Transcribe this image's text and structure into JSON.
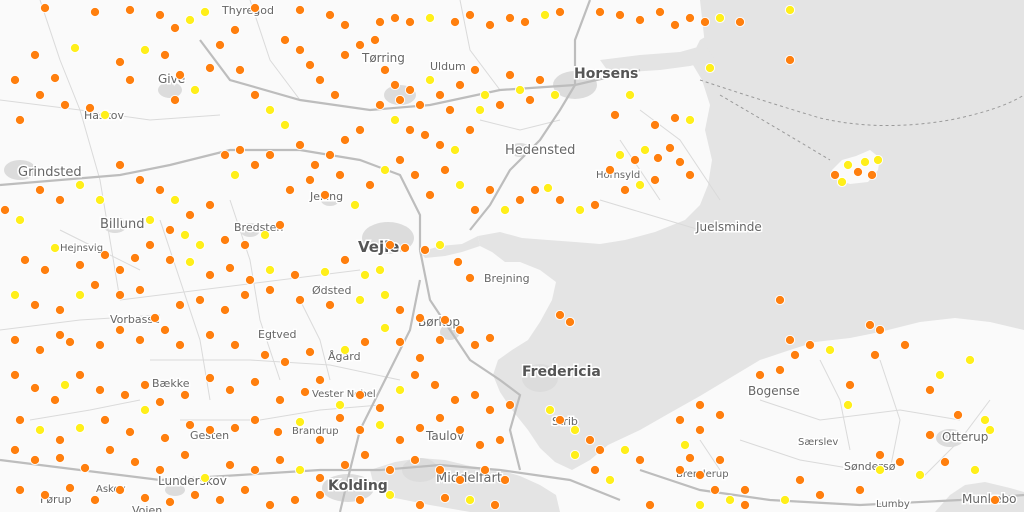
{
  "map": {
    "colors": {
      "land": "#fafafa",
      "sea": "#e4e4e4",
      "urban": "#dcdcdc",
      "road_major": "#bdbdbd",
      "road_minor": "#dadada",
      "ferry": "#9a9a9a",
      "marker_orange": "#ff7f0e",
      "marker_yellow": "#ffef1a"
    },
    "towns": [
      {
        "id": "thyregod",
        "name": "Thyregod"
      },
      {
        "id": "torring",
        "name": "Tørring"
      },
      {
        "id": "uldum",
        "name": "Uldum"
      },
      {
        "id": "horsens",
        "name": "Horsens"
      },
      {
        "id": "give",
        "name": "Give"
      },
      {
        "id": "haskov",
        "name": "Haskov"
      },
      {
        "id": "hedensted",
        "name": "Hedensted"
      },
      {
        "id": "grindsted",
        "name": "Grindsted"
      },
      {
        "id": "juelsminde",
        "name": "Juelsminde"
      },
      {
        "id": "hornsyld",
        "name": "Hornsyld"
      },
      {
        "id": "jelling",
        "name": "Jelling"
      },
      {
        "id": "billund",
        "name": "Billund"
      },
      {
        "id": "bredsten",
        "name": "Bredsten"
      },
      {
        "id": "vejle",
        "name": "Vejle"
      },
      {
        "id": "hejnsvig",
        "name": "Hejnsvig"
      },
      {
        "id": "brejning",
        "name": "Brejning"
      },
      {
        "id": "odsted",
        "name": "Ødsted"
      },
      {
        "id": "vorbasse",
        "name": "Vorbasse"
      },
      {
        "id": "egtved",
        "name": "Egtved"
      },
      {
        "id": "borkop",
        "name": "Børkop"
      },
      {
        "id": "agard",
        "name": "Ågård"
      },
      {
        "id": "fredericia",
        "name": "Fredericia"
      },
      {
        "id": "baekke",
        "name": "Bække"
      },
      {
        "id": "vester-nebel",
        "name": "Vester Nebel"
      },
      {
        "id": "bogense",
        "name": "Bogense"
      },
      {
        "id": "strib",
        "name": "Strib"
      },
      {
        "id": "gesten",
        "name": "Gesten"
      },
      {
        "id": "bramdrup",
        "name": "Brandrup"
      },
      {
        "id": "taulov",
        "name": "Taulov"
      },
      {
        "id": "saersleo",
        "name": "Særslev"
      },
      {
        "id": "otterup",
        "name": "Otterup"
      },
      {
        "id": "lunderskov",
        "name": "Lunderskov"
      },
      {
        "id": "kolding",
        "name": "Kolding"
      },
      {
        "id": "middelfart",
        "name": "Middelfart"
      },
      {
        "id": "brenderup",
        "name": "Brenderup"
      },
      {
        "id": "sonderso",
        "name": "Søndersø"
      },
      {
        "id": "askov",
        "name": "Askov"
      },
      {
        "id": "farup",
        "name": "Førup"
      },
      {
        "id": "lumby",
        "name": "Lumby"
      },
      {
        "id": "munkebo",
        "name": "Munkebo"
      },
      {
        "id": "vojen",
        "name": "Vojen"
      }
    ]
  }
}
